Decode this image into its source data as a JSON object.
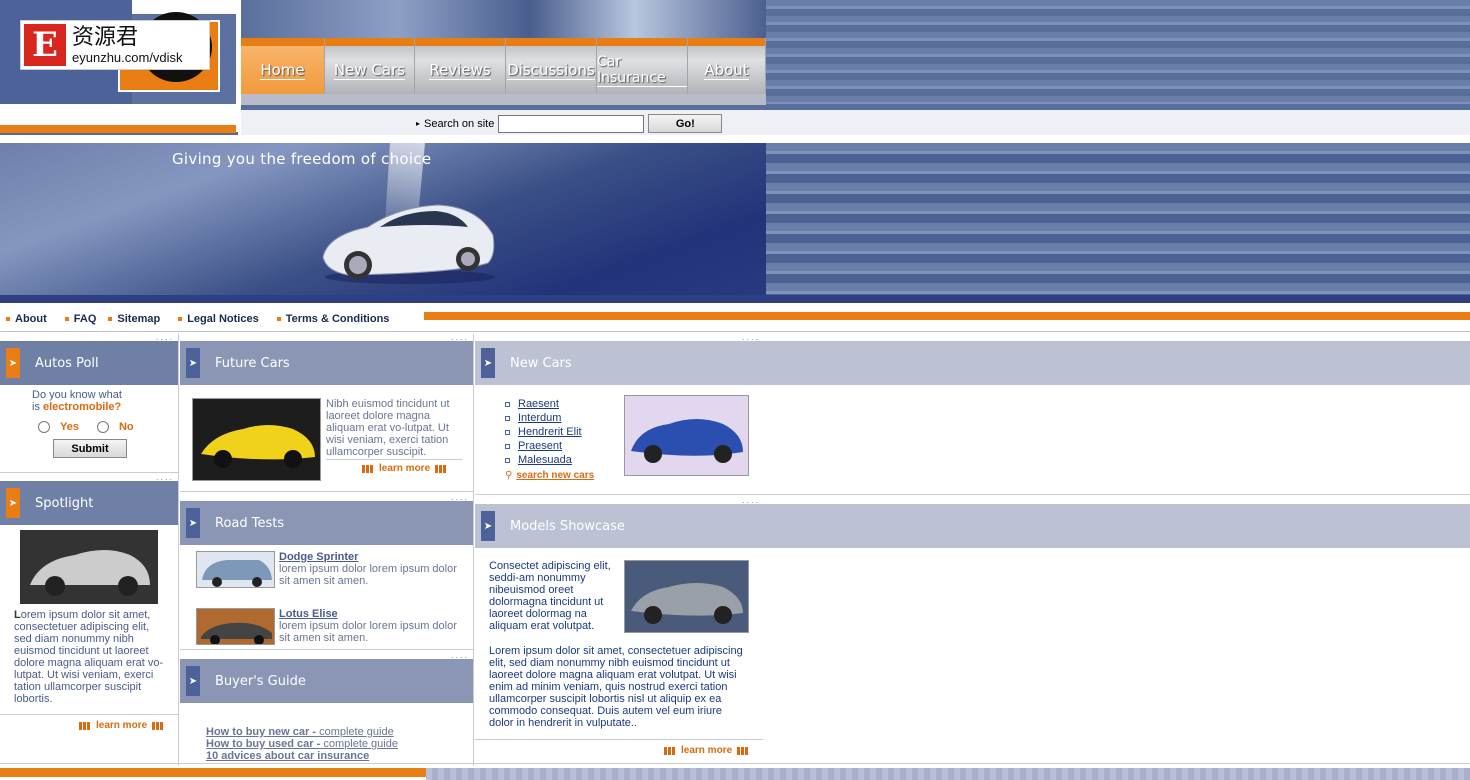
{
  "watermark": {
    "cn": "资源君",
    "url": "eyunzhu.com/vdisk",
    "letter": "E"
  },
  "nav": {
    "items": [
      "Home",
      "New Cars",
      "Reviews",
      "Discussions",
      "Car Insurance",
      "About"
    ]
  },
  "search": {
    "label": "Search on site",
    "button": "Go!"
  },
  "banner": {
    "tagline": "Giving you the freedom of choice"
  },
  "subnav": [
    "About",
    "FAQ",
    "Sitemap",
    "Legal Notices",
    "Terms & Conditions"
  ],
  "poll": {
    "title": "Autos Poll",
    "q1": "Do you know what",
    "q2": "is ",
    "q_em": "electromobile?",
    "yes": "Yes",
    "no": "No",
    "submit": "Submit"
  },
  "spotlight": {
    "title": "Spotlight",
    "initial": "L",
    "text": "orem ipsum dolor sit amet, consectetuer adipiscing elit, sed diam nonummy nibh euismod tincidunt ut laoreet dolore magna aliquam erat vo-lutpat. Ut wisi veniam, exerci tation ullamcorper suscipit lobortis.",
    "learn_more": "learn more"
  },
  "future": {
    "title": "Future Cars",
    "text": "Nibh euismod tincidunt ut laoreet dolore magna aliquam erat vo-lutpat. Ut wisi veniam, exerci tation ullamcorper suscipit.",
    "learn_more": "learn more"
  },
  "road": {
    "title": "Road Tests",
    "items": [
      {
        "name": "Dodge Sprinter",
        "text": "lorem ipsum dolor lorem ipsum dolor sit amen sit amen."
      },
      {
        "name": "Lotus Elise",
        "text": "lorem ipsum dolor lorem ipsum dolor sit amen sit amen."
      }
    ]
  },
  "buyers": {
    "title": "Buyer's Guide",
    "links": [
      {
        "bold": "How to buy new car - ",
        "rest": "complete guide"
      },
      {
        "bold": "How to buy used car - ",
        "rest": "complete guide"
      },
      {
        "bold": "10 advices about car insurance",
        "rest": ""
      }
    ]
  },
  "newcars": {
    "title": "New Cars",
    "links": [
      "Raesent",
      "Interdum",
      "Hendrerit Elit",
      "Praesent",
      "Malesuada"
    ],
    "search": "search new cars"
  },
  "models": {
    "title": "Models Showcase",
    "text1": "Consectet adipiscing elit, seddi-am nonummy nibeuismod oreet dolormagna tincidunt ut laoreet dolormag na aliquam erat volutpat.",
    "text2": "Lorem ipsum dolor sit amet, consectetuer adipiscing elit, sed diam nonummy nibh euismod tincidunt ut laoreet dolore magna aliquam erat volutpat. Ut wisi enim ad minim veniam, quis nostrud exerci tation ullamcorper suscipit lobortis nisl ut aliquip ex ea commodo consequat. Duis autem vel eum iriure dolor in hendrerit in vulputate..",
    "learn_more": "learn more"
  },
  "colors": {
    "accent": "#e87d14",
    "blue": "#5f73a0",
    "headerGrey": "#8a96b4",
    "headerLight": "#bcc2d4"
  }
}
